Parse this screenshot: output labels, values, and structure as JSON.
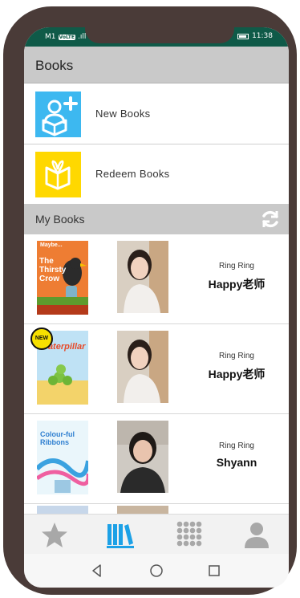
{
  "status_bar": {
    "carrier": "M1",
    "volte": "VoLTE",
    "signal": ".ıll",
    "time": "11:38"
  },
  "header": {
    "title": "Books"
  },
  "menu": [
    {
      "label": "New Books",
      "icon": "new-book-icon"
    },
    {
      "label": "Redeem Books",
      "icon": "gift-book-icon"
    }
  ],
  "my_books": {
    "title": "My Books",
    "refresh_icon": "refresh-icon",
    "items": [
      {
        "cover": "The Thirsty Crow",
        "cover_top": "Maybe...",
        "ring": "Ring Ring",
        "teacher": "Happy老师"
      },
      {
        "cover": "Caterpillar",
        "badge": "NEW",
        "ring": "Ring Ring",
        "teacher": "Happy老师"
      },
      {
        "cover": "Colour-ful Ribbons",
        "ring": "Ring Ring",
        "teacher": "Shyann"
      }
    ]
  },
  "bottom_nav": [
    {
      "icon": "star-icon",
      "active": false
    },
    {
      "icon": "bookshelf-icon",
      "active": true
    },
    {
      "icon": "grid-icon",
      "active": false
    },
    {
      "icon": "profile-icon",
      "active": false
    }
  ],
  "colors": {
    "status_bar": "#0f5a48",
    "accent_blue": "#3db8f0",
    "accent_yellow": "#ffd800",
    "header_gray": "#c9c9c9"
  }
}
